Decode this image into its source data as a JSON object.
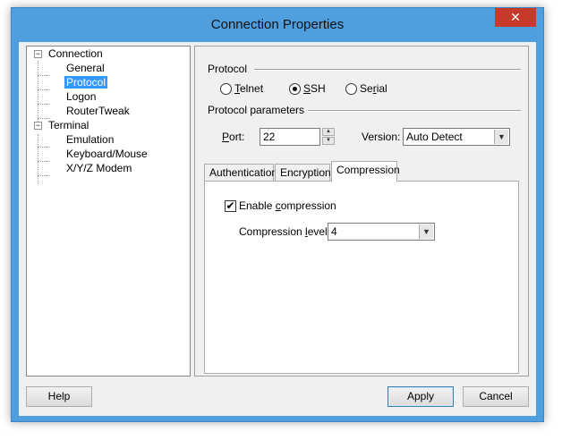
{
  "window": {
    "title": "Connection Properties",
    "close_glyph": "✕"
  },
  "tree": {
    "connection": "Connection",
    "general": "General",
    "protocol": "Protocol",
    "logon": "Logon",
    "routertweak": "RouterTweak",
    "terminal": "Terminal",
    "emulation": "Emulation",
    "keyboard": "Keyboard/Mouse",
    "xyz": "X/Y/Z Modem",
    "expander_glyph": "−"
  },
  "protocol": {
    "group_label": "Protocol",
    "telnet": {
      "prefix": "",
      "key": "T",
      "suffix": "elnet"
    },
    "ssh": {
      "prefix": "",
      "key": "S",
      "suffix": "SH"
    },
    "serial": {
      "prefix": "Se",
      "key": "r",
      "suffix": "ial"
    },
    "selected": "ssh"
  },
  "params": {
    "group_label": "Protocol parameters",
    "port_key": "P",
    "port_suffix": "ort:",
    "port_value": "22",
    "version_label": "Version:",
    "version_value": "Auto Detect"
  },
  "tabs": {
    "authentication": "Authentication",
    "encryption": "Encryption",
    "compression": "Compression",
    "active": "compression"
  },
  "compression": {
    "enable_prefix": "Enable ",
    "enable_key": "c",
    "enable_suffix": "ompression",
    "enable_checked": true,
    "check_glyph": "✔",
    "level_prefix": "Compression ",
    "level_key": "l",
    "level_suffix": "evel:",
    "level_value": "4"
  },
  "buttons": {
    "help": "Help",
    "apply": "Apply",
    "cancel": "Cancel"
  },
  "icons": {
    "dropdown": "▼",
    "spin_up": "▲",
    "spin_down": "▼"
  },
  "colors": {
    "titlebar": "#4f9fde",
    "selection": "#3399ff",
    "close": "#c7392b"
  }
}
